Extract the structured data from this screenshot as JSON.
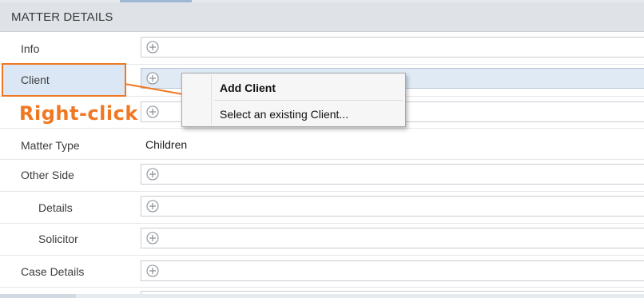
{
  "header": {
    "title": "MATTER DETAILS"
  },
  "rows": {
    "info": {
      "label": "Info"
    },
    "client": {
      "label": "Client"
    },
    "matter_type": {
      "label": "Matter Type",
      "value": "Children"
    },
    "other_side": {
      "label": "Other Side"
    },
    "details": {
      "label": "Details"
    },
    "solicitor": {
      "label": "Solicitor"
    },
    "case_details": {
      "label": "Case Details"
    }
  },
  "annotation": {
    "text": "Right-click",
    "color": "#f07822"
  },
  "context_menu": {
    "items": [
      {
        "label": "Add Client",
        "bold": true
      },
      {
        "label": "Select an existing Client..."
      }
    ]
  },
  "icons": {
    "add": "plus-circle-icon"
  }
}
